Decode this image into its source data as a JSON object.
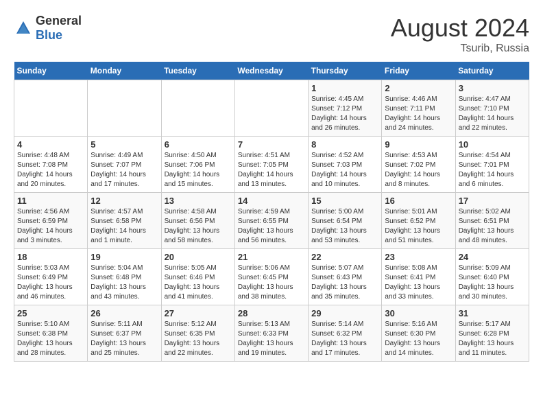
{
  "header": {
    "logo": {
      "general": "General",
      "blue": "Blue"
    },
    "title": "August 2024",
    "subtitle": "Tsurib, Russia"
  },
  "calendar": {
    "days_of_week": [
      "Sunday",
      "Monday",
      "Tuesday",
      "Wednesday",
      "Thursday",
      "Friday",
      "Saturday"
    ],
    "weeks": [
      [
        {
          "date": "",
          "info": ""
        },
        {
          "date": "",
          "info": ""
        },
        {
          "date": "",
          "info": ""
        },
        {
          "date": "",
          "info": ""
        },
        {
          "date": "1",
          "info": "Sunrise: 4:45 AM\nSunset: 7:12 PM\nDaylight: 14 hours and 26 minutes."
        },
        {
          "date": "2",
          "info": "Sunrise: 4:46 AM\nSunset: 7:11 PM\nDaylight: 14 hours and 24 minutes."
        },
        {
          "date": "3",
          "info": "Sunrise: 4:47 AM\nSunset: 7:10 PM\nDaylight: 14 hours and 22 minutes."
        }
      ],
      [
        {
          "date": "4",
          "info": "Sunrise: 4:48 AM\nSunset: 7:08 PM\nDaylight: 14 hours and 20 minutes."
        },
        {
          "date": "5",
          "info": "Sunrise: 4:49 AM\nSunset: 7:07 PM\nDaylight: 14 hours and 17 minutes."
        },
        {
          "date": "6",
          "info": "Sunrise: 4:50 AM\nSunset: 7:06 PM\nDaylight: 14 hours and 15 minutes."
        },
        {
          "date": "7",
          "info": "Sunrise: 4:51 AM\nSunset: 7:05 PM\nDaylight: 14 hours and 13 minutes."
        },
        {
          "date": "8",
          "info": "Sunrise: 4:52 AM\nSunset: 7:03 PM\nDaylight: 14 hours and 10 minutes."
        },
        {
          "date": "9",
          "info": "Sunrise: 4:53 AM\nSunset: 7:02 PM\nDaylight: 14 hours and 8 minutes."
        },
        {
          "date": "10",
          "info": "Sunrise: 4:54 AM\nSunset: 7:01 PM\nDaylight: 14 hours and 6 minutes."
        }
      ],
      [
        {
          "date": "11",
          "info": "Sunrise: 4:56 AM\nSunset: 6:59 PM\nDaylight: 14 hours and 3 minutes."
        },
        {
          "date": "12",
          "info": "Sunrise: 4:57 AM\nSunset: 6:58 PM\nDaylight: 14 hours and 1 minute."
        },
        {
          "date": "13",
          "info": "Sunrise: 4:58 AM\nSunset: 6:56 PM\nDaylight: 13 hours and 58 minutes."
        },
        {
          "date": "14",
          "info": "Sunrise: 4:59 AM\nSunset: 6:55 PM\nDaylight: 13 hours and 56 minutes."
        },
        {
          "date": "15",
          "info": "Sunrise: 5:00 AM\nSunset: 6:54 PM\nDaylight: 13 hours and 53 minutes."
        },
        {
          "date": "16",
          "info": "Sunrise: 5:01 AM\nSunset: 6:52 PM\nDaylight: 13 hours and 51 minutes."
        },
        {
          "date": "17",
          "info": "Sunrise: 5:02 AM\nSunset: 6:51 PM\nDaylight: 13 hours and 48 minutes."
        }
      ],
      [
        {
          "date": "18",
          "info": "Sunrise: 5:03 AM\nSunset: 6:49 PM\nDaylight: 13 hours and 46 minutes."
        },
        {
          "date": "19",
          "info": "Sunrise: 5:04 AM\nSunset: 6:48 PM\nDaylight: 13 hours and 43 minutes."
        },
        {
          "date": "20",
          "info": "Sunrise: 5:05 AM\nSunset: 6:46 PM\nDaylight: 13 hours and 41 minutes."
        },
        {
          "date": "21",
          "info": "Sunrise: 5:06 AM\nSunset: 6:45 PM\nDaylight: 13 hours and 38 minutes."
        },
        {
          "date": "22",
          "info": "Sunrise: 5:07 AM\nSunset: 6:43 PM\nDaylight: 13 hours and 35 minutes."
        },
        {
          "date": "23",
          "info": "Sunrise: 5:08 AM\nSunset: 6:41 PM\nDaylight: 13 hours and 33 minutes."
        },
        {
          "date": "24",
          "info": "Sunrise: 5:09 AM\nSunset: 6:40 PM\nDaylight: 13 hours and 30 minutes."
        }
      ],
      [
        {
          "date": "25",
          "info": "Sunrise: 5:10 AM\nSunset: 6:38 PM\nDaylight: 13 hours and 28 minutes."
        },
        {
          "date": "26",
          "info": "Sunrise: 5:11 AM\nSunset: 6:37 PM\nDaylight: 13 hours and 25 minutes."
        },
        {
          "date": "27",
          "info": "Sunrise: 5:12 AM\nSunset: 6:35 PM\nDaylight: 13 hours and 22 minutes."
        },
        {
          "date": "28",
          "info": "Sunrise: 5:13 AM\nSunset: 6:33 PM\nDaylight: 13 hours and 19 minutes."
        },
        {
          "date": "29",
          "info": "Sunrise: 5:14 AM\nSunset: 6:32 PM\nDaylight: 13 hours and 17 minutes."
        },
        {
          "date": "30",
          "info": "Sunrise: 5:16 AM\nSunset: 6:30 PM\nDaylight: 13 hours and 14 minutes."
        },
        {
          "date": "31",
          "info": "Sunrise: 5:17 AM\nSunset: 6:28 PM\nDaylight: 13 hours and 11 minutes."
        }
      ]
    ]
  }
}
